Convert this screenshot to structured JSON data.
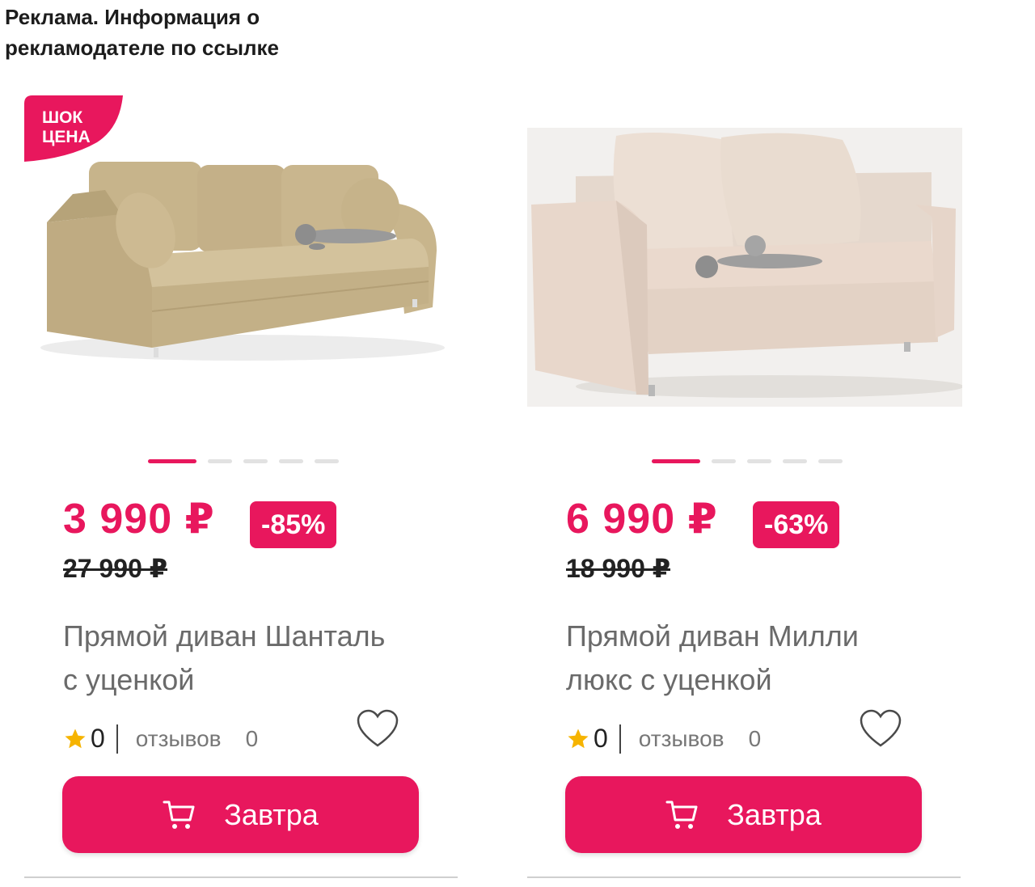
{
  "ad_notice": "Реклама. Информация о рекламодателе по ссылке",
  "colors": {
    "accent": "#e8175d",
    "star": "#f6b400"
  },
  "products": [
    {
      "badge": "ШОК ЦЕНА",
      "price": "3 990 ₽",
      "discount": "-85%",
      "old_price": "27 990 ₽",
      "title": "Прямой диван Шанталь с уценкой",
      "rating": "0",
      "reviews_label": "отзывов",
      "reviews_count": "0",
      "button_label": "Завтра",
      "gallery": {
        "slides": 5,
        "active": 1
      }
    },
    {
      "price": "6 990 ₽",
      "discount": "-63%",
      "old_price": "18 990 ₽",
      "title": "Прямой диван Милли люкс с уценкой",
      "rating": "0",
      "reviews_label": "отзывов",
      "reviews_count": "0",
      "button_label": "Завтра",
      "gallery": {
        "slides": 5,
        "active": 1
      }
    }
  ],
  "icons": [
    "star-icon",
    "heart-icon",
    "cart-icon"
  ]
}
